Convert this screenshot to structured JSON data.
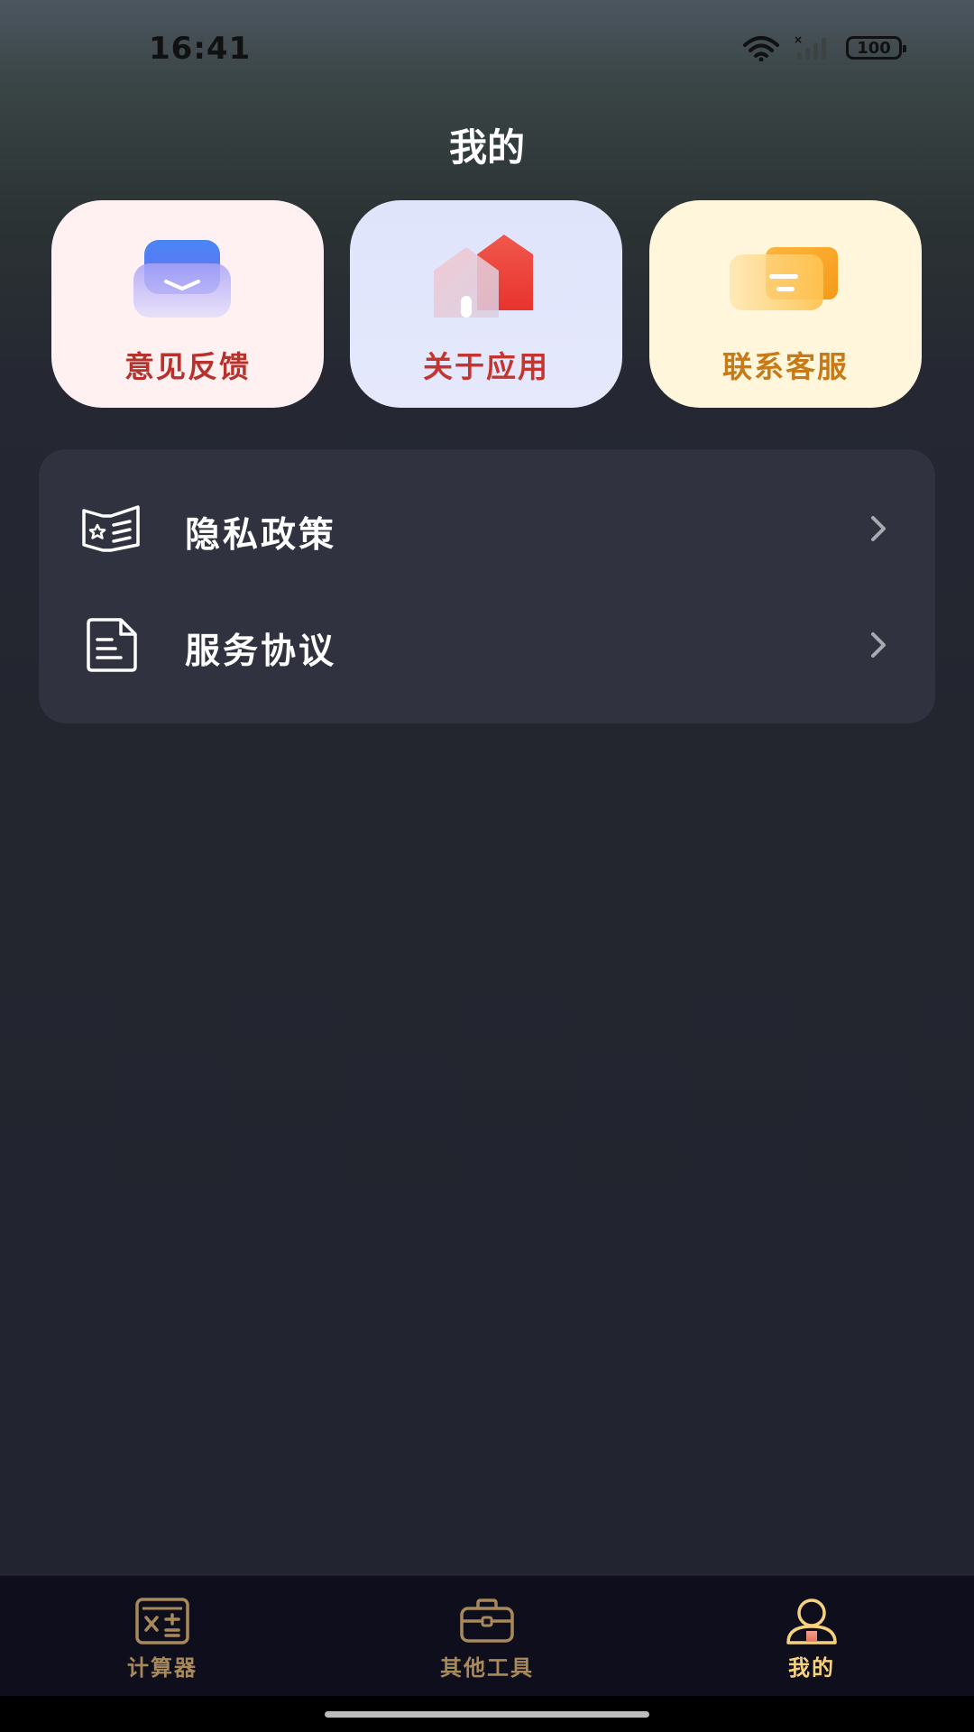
{
  "status_bar": {
    "time": "16:41",
    "battery": "100"
  },
  "page_title": "我的",
  "quick_cards": [
    {
      "label": "意见反馈",
      "icon": "inbox-icon",
      "color": "#b8322c"
    },
    {
      "label": "关于应用",
      "icon": "house-icon",
      "color": "#c33630"
    },
    {
      "label": "联系客服",
      "icon": "chat-bubble-icon",
      "color": "#c67a18"
    }
  ],
  "menu": [
    {
      "label": "隐私政策",
      "icon": "privacy-book-icon"
    },
    {
      "label": "服务协议",
      "icon": "document-icon"
    }
  ],
  "tabs": [
    {
      "label": "计算器",
      "icon": "calculator-icon",
      "active": false
    },
    {
      "label": "其他工具",
      "icon": "toolbox-icon",
      "active": false
    },
    {
      "label": "我的",
      "icon": "user-icon",
      "active": true
    }
  ],
  "colors": {
    "tab_active": "#f6d27d",
    "tab_inactive": "#a8895a",
    "panel": "#30323f",
    "background": "#22242f"
  }
}
